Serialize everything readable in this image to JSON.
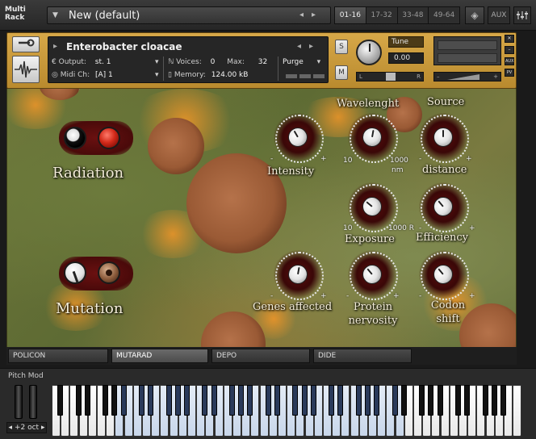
{
  "rack": {
    "label": "Multi Rack",
    "preset_name": "New (default)",
    "banks": [
      "01-16",
      "17-32",
      "33-48",
      "49-64"
    ],
    "active_bank": 0,
    "aux_label": "AUX"
  },
  "instrument": {
    "name": "Enterobacter cloacae",
    "output_label": "Output:",
    "output_value": "st. 1",
    "voices_label": "Voices:",
    "voices_value": "0",
    "max_label": "Max:",
    "max_value": "32",
    "purge_label": "Purge",
    "midi_label": "Midi Ch:",
    "midi_value": "[A] 1",
    "memory_label": "Memory:",
    "memory_value": "124.00 kB",
    "solo_label": "S",
    "mute_label": "M",
    "tune_label": "Tune",
    "tune_value": "0.00",
    "pan_left": "L",
    "pan_right": "R",
    "side_aux": "AUX",
    "side_pv": "PV"
  },
  "panel": {
    "radiation_label": "Radiation",
    "mutation_label": "Mutation",
    "wavelength_label": "Wavelenght",
    "source_label": "Source",
    "intensity_label": "Intensity",
    "distance_label": "distance",
    "exposure_label": "Exposure",
    "efficiency_label": "Efficiency",
    "genes_label": "Genes affected",
    "protein_label": "Protein nervosity",
    "codon_label": "Codon shift",
    "wave_min": "10",
    "wave_max": "1000",
    "wave_unit": "nm",
    "exp_min": "10",
    "exp_max": "1000 R",
    "minus": "-",
    "plus": "+"
  },
  "tabs": [
    "POLICON",
    "MUTARAD",
    "DEPO",
    "DIDE"
  ],
  "active_tab": 1,
  "keyboard": {
    "pitch_mod_label": "Pitch Mod",
    "octave_label": "+2 oct"
  }
}
